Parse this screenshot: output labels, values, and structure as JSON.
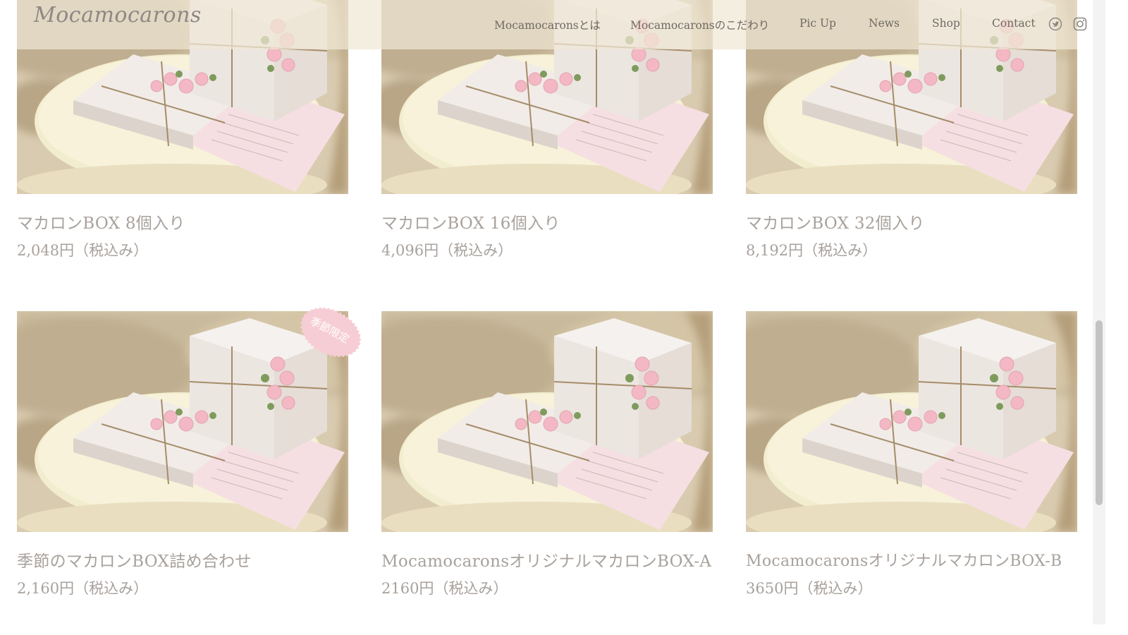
{
  "header": {
    "logo": "Mocamocarons",
    "nav": [
      {
        "label": "Mocamocaronsとは"
      },
      {
        "label": "Mocamocaronsのこだわり"
      },
      {
        "label": "Pic Up"
      },
      {
        "label": "News"
      },
      {
        "label": "Shop"
      },
      {
        "label": "Contact"
      }
    ],
    "social": [
      "twitter-icon",
      "instagram-icon"
    ]
  },
  "products": [
    {
      "name": "マカロンBOX 8個入り",
      "price": "2,048円（税込み）"
    },
    {
      "name": "マカロンBOX 16個入り",
      "price": "4,096円（税込み）"
    },
    {
      "name": "マカロンBOX 32個入り",
      "price": "8,192円（税込み）"
    },
    {
      "name": "季節のマカロンBOX詰め合わせ",
      "price": "2,160円（税込み）",
      "badge": "季節限定"
    },
    {
      "name": "MocamocaronsオリジナルマカロンBOX-A",
      "price": "2160円（税込み）"
    },
    {
      "name": "MocamocaronsオリジナルマカロンBOX-B",
      "price": "3650円（税込み）"
    }
  ],
  "colors": {
    "header_bg": "#f0e8d6",
    "nav_text": "#6f6964",
    "product_text": "#a8a19c",
    "badge": "#f5c8cf"
  }
}
